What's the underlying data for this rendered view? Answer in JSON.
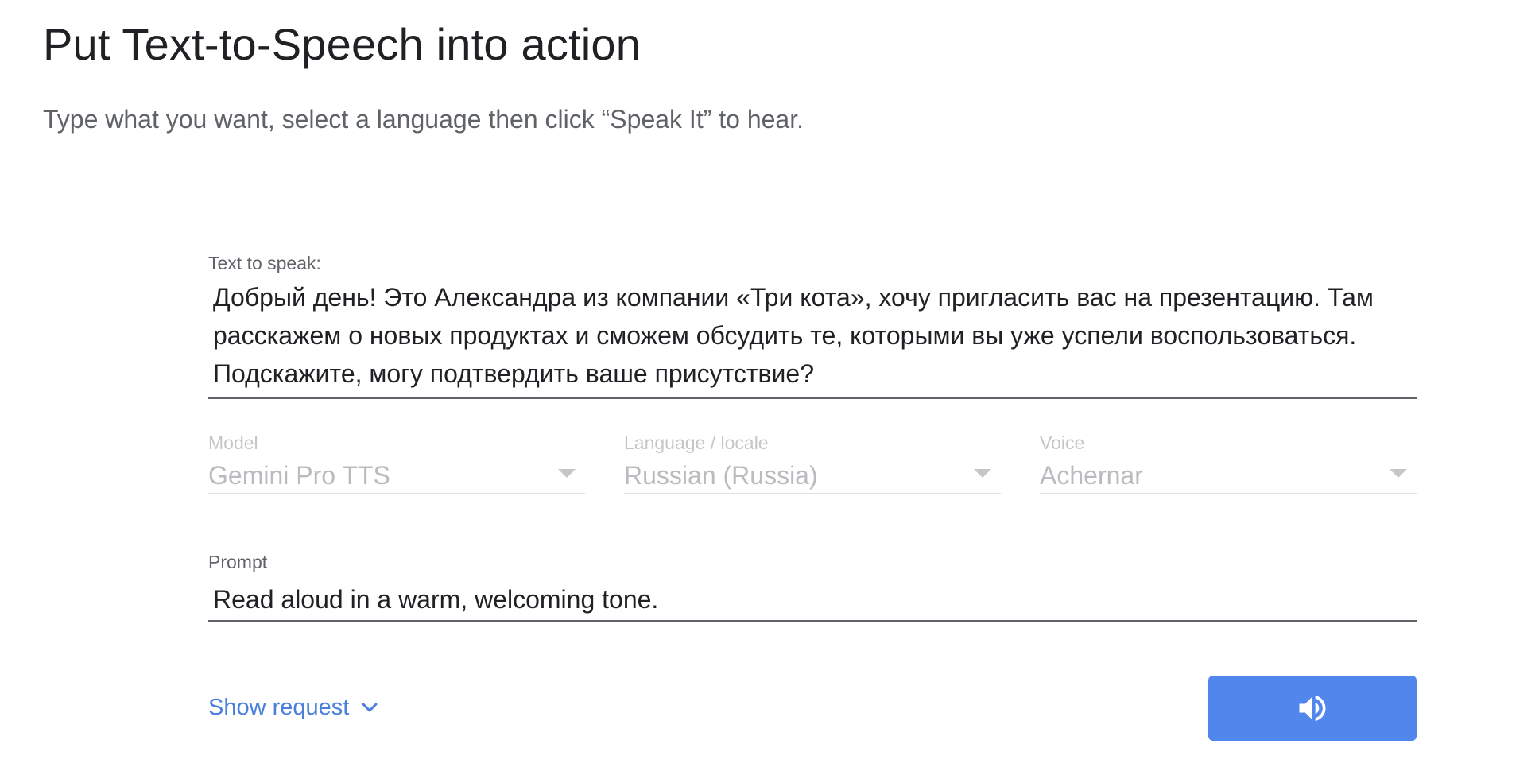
{
  "header": {
    "title": "Put Text-to-Speech into action",
    "subtitle": "Type what you want, select a language then click “Speak It” to hear."
  },
  "form": {
    "text_to_speak": {
      "label": "Text to speak:",
      "value": "Добрый день! Это Александра из компании «Три кота», хочу пригласить вас на презентацию. Там расскажем о новых продуктах и сможем обсудить те, которыми вы уже успели воспользоваться. Подскажите, могу подтвердить ваше присутствие?"
    },
    "model": {
      "label": "Model",
      "value": "Gemini Pro TTS"
    },
    "language": {
      "label": "Language / locale",
      "value": "Russian (Russia)"
    },
    "voice": {
      "label": "Voice",
      "value": "Achernar"
    },
    "prompt": {
      "label": "Prompt",
      "value": "Read aloud in a warm, welcoming tone."
    }
  },
  "actions": {
    "show_request_label": "Show request",
    "show_request_icon": "chevron-down-icon",
    "speak_icon": "speaker-icon"
  },
  "colors": {
    "accent": "#5186ec",
    "link": "#4a7fdc",
    "text_primary": "#202124",
    "text_secondary": "#5f6368",
    "disabled": "#c4c7c5"
  }
}
